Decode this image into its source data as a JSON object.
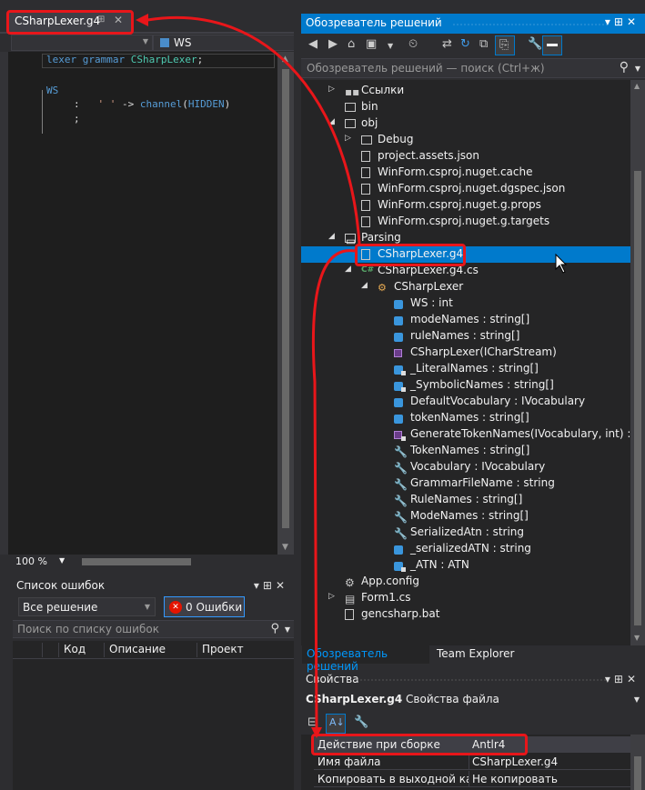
{
  "editor": {
    "tab_title": "CSharpLexer.g4",
    "nav_right_value": "WS",
    "code": {
      "line1_kw": "lexer grammar ",
      "line1_id": "CSharpLexer",
      "line1_end": ";",
      "line2": "WS",
      "line3_colon": ":",
      "line3_str": "' '",
      "line3_arrow": " -> ",
      "line3_channel": "channel",
      "line3_open": "(",
      "line3_hidden": "HIDDEN",
      "line3_close": ")",
      "line4": ";"
    },
    "zoom": "100 %"
  },
  "error_list": {
    "title": "Список ошибок",
    "scope": "Все решение",
    "errors_label": "0 Ошибки",
    "search_placeholder": "Поиск по списку ошибок",
    "columns": [
      "Код",
      "Описание",
      "Проект"
    ]
  },
  "solution_explorer": {
    "title": "Обозреватель решений",
    "search_placeholder": "Обозреватель решений — поиск (Ctrl+ж)",
    "tree": [
      {
        "label": "Ссылки",
        "depth": 1,
        "icon": "references-icon",
        "expander": "collapsed"
      },
      {
        "label": "bin",
        "depth": 1,
        "icon": "folder-icon",
        "expander": "none"
      },
      {
        "label": "obj",
        "depth": 1,
        "icon": "folder-icon",
        "expander": "expanded"
      },
      {
        "label": "Debug",
        "depth": 2,
        "icon": "folder-icon",
        "expander": "collapsed"
      },
      {
        "label": "project.assets.json",
        "depth": 2,
        "icon": "file-icon",
        "expander": "none"
      },
      {
        "label": "WinForm.csproj.nuget.cache",
        "depth": 2,
        "icon": "file-icon",
        "expander": "none"
      },
      {
        "label": "WinForm.csproj.nuget.dgspec.json",
        "depth": 2,
        "icon": "file-icon",
        "expander": "none"
      },
      {
        "label": "WinForm.csproj.nuget.g.props",
        "depth": 2,
        "icon": "file-icon",
        "expander": "none"
      },
      {
        "label": "WinForm.csproj.nuget.g.targets",
        "depth": 2,
        "icon": "file-icon",
        "expander": "none"
      },
      {
        "label": "Parsing",
        "depth": 1,
        "icon": "open-folder-icon",
        "expander": "expanded"
      },
      {
        "label": "CSharpLexer.g4",
        "depth": 2,
        "icon": "file-icon",
        "expander": "none",
        "selected": true
      },
      {
        "label": "CSharpLexer.g4.cs",
        "depth": 2,
        "icon": "csharp-file-icon",
        "expander": "expanded"
      },
      {
        "label": "CSharpLexer",
        "depth": 3,
        "icon": "class-icon",
        "expander": "expanded"
      },
      {
        "label": "WS : int",
        "depth": 4,
        "icon": "field-icon"
      },
      {
        "label": "modeNames : string[]",
        "depth": 4,
        "icon": "field-icon"
      },
      {
        "label": "ruleNames : string[]",
        "depth": 4,
        "icon": "field-icon"
      },
      {
        "label": "CSharpLexer(ICharStream)",
        "depth": 4,
        "icon": "method-icon"
      },
      {
        "label": "_LiteralNames : string[]",
        "depth": 4,
        "icon": "private-field-icon"
      },
      {
        "label": "_SymbolicNames : string[]",
        "depth": 4,
        "icon": "private-field-icon"
      },
      {
        "label": "DefaultVocabulary : IVocabulary",
        "depth": 4,
        "icon": "field-icon"
      },
      {
        "label": "tokenNames : string[]",
        "depth": 4,
        "icon": "field-icon"
      },
      {
        "label": "GenerateTokenNames(IVocabulary, int) : strin",
        "depth": 4,
        "icon": "private-method-icon"
      },
      {
        "label": "TokenNames : string[]",
        "depth": 4,
        "icon": "property-icon"
      },
      {
        "label": "Vocabulary : IVocabulary",
        "depth": 4,
        "icon": "property-icon"
      },
      {
        "label": "GrammarFileName : string",
        "depth": 4,
        "icon": "property-icon"
      },
      {
        "label": "RuleNames : string[]",
        "depth": 4,
        "icon": "property-icon"
      },
      {
        "label": "ModeNames : string[]",
        "depth": 4,
        "icon": "property-icon"
      },
      {
        "label": "SerializedAtn : string",
        "depth": 4,
        "icon": "property-icon"
      },
      {
        "label": "_serializedATN : string",
        "depth": 4,
        "icon": "field-icon"
      },
      {
        "label": "_ATN : ATN",
        "depth": 4,
        "icon": "private-field-icon"
      },
      {
        "label": "App.config",
        "depth": 1,
        "icon": "config-icon",
        "expander": "none"
      },
      {
        "label": "Form1.cs",
        "depth": 1,
        "icon": "form-icon",
        "expander": "collapsed"
      },
      {
        "label": "gencsharp.bat",
        "depth": 1,
        "icon": "file-icon",
        "expander": "none"
      }
    ],
    "tabs": [
      "Обозреватель решений",
      "Team Explorer"
    ]
  },
  "properties": {
    "title": "Свойства",
    "object_name": "CSharpLexer.g4",
    "object_type": "Свойства файла",
    "rows": [
      {
        "key": "Действие при сборке",
        "value": "Antlr4"
      },
      {
        "key": "Имя файла",
        "value": "CSharpLexer.g4"
      },
      {
        "key": "Копировать в выходной катал",
        "value": "Не копировать"
      }
    ]
  },
  "colors": {
    "accent": "#007acc",
    "annotation": "#e8161a",
    "background": "#2d2d30",
    "tree_background": "#252526"
  }
}
